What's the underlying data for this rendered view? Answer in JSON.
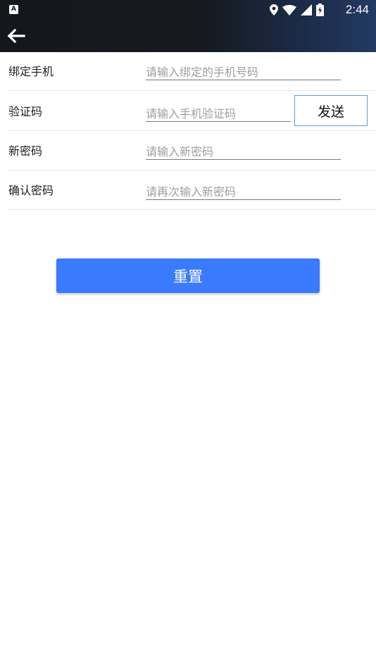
{
  "status_bar": {
    "app_indicator": "A",
    "time": "2:44"
  },
  "toolbar": {
    "back_icon": "arrow-left-icon"
  },
  "form": {
    "rows": [
      {
        "label": "绑定手机",
        "placeholder": "请输入绑定的手机号码"
      },
      {
        "label": "验证码",
        "placeholder": "请输入手机验证码"
      },
      {
        "label": "新密码",
        "placeholder": "请输入新密码"
      },
      {
        "label": "确认密码",
        "placeholder": "请再次输入新密码"
      }
    ],
    "send_label": "发送"
  },
  "reset_label": "重置",
  "colors": {
    "primary": "#3a7afe",
    "send_border": "#5a9fd6"
  }
}
